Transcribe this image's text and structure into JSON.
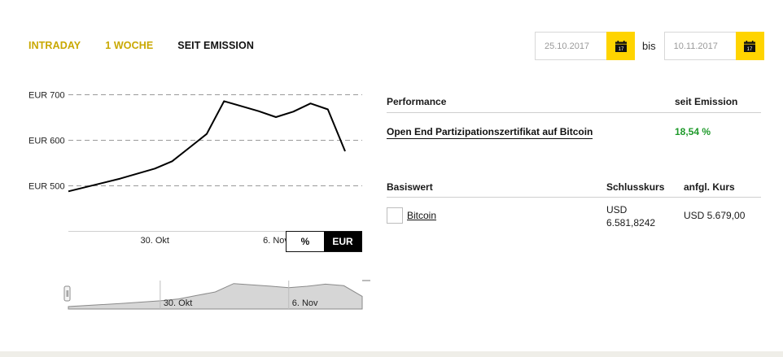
{
  "tabs": [
    {
      "label": "INTRADAY"
    },
    {
      "label": "1 WOCHE"
    },
    {
      "label": "SEIT EMISSION"
    }
  ],
  "date_range": {
    "from": "25.10.2017",
    "separator": "bis",
    "to": "10.11.2017",
    "calendar_day": "17"
  },
  "unit_toggle": {
    "percent": "%",
    "eur": "EUR"
  },
  "performance": {
    "header_left": "Performance",
    "header_right": "seit Emission",
    "product": "Open End Partizipationszertifikat auf Bitcoin",
    "value": "18,54 %"
  },
  "underlying": {
    "header_name": "Basiswert",
    "header_close": "Schlusskurs",
    "header_initial": "anfgl. Kurs",
    "name": "Bitcoin",
    "close_line1": "USD",
    "close_line2": "6.581,8242",
    "initial": "USD 5.679,00"
  },
  "colors": {
    "accent": "#ffd400",
    "tab_inactive": "#c9a800",
    "positive": "#1f9a2b"
  },
  "chart_data": {
    "type": "line",
    "y_ticks": [
      "EUR 500",
      "EUR 600",
      "EUR 700"
    ],
    "x_ticks": [
      "30. Okt",
      "6. Nov"
    ],
    "ylim": [
      480,
      720
    ],
    "grid": true,
    "series": [
      {
        "values": [
          {
            "x": "2017-10-25",
            "y": 487
          },
          {
            "x": "2017-10-28",
            "y": 515
          },
          {
            "x": "2017-10-30",
            "y": 537
          },
          {
            "x": "2017-10-31",
            "y": 553
          },
          {
            "x": "2017-11-01",
            "y": 583
          },
          {
            "x": "2017-11-02",
            "y": 613
          },
          {
            "x": "2017-11-03",
            "y": 685
          },
          {
            "x": "2017-11-05",
            "y": 663
          },
          {
            "x": "2017-11-06",
            "y": 650
          },
          {
            "x": "2017-11-07",
            "y": 662
          },
          {
            "x": "2017-11-08",
            "y": 680
          },
          {
            "x": "2017-11-09",
            "y": 667
          },
          {
            "x": "2017-11-10",
            "y": 575
          }
        ]
      }
    ],
    "navigator": {
      "x_ticks": [
        "30. Okt",
        "6. Nov"
      ]
    }
  }
}
